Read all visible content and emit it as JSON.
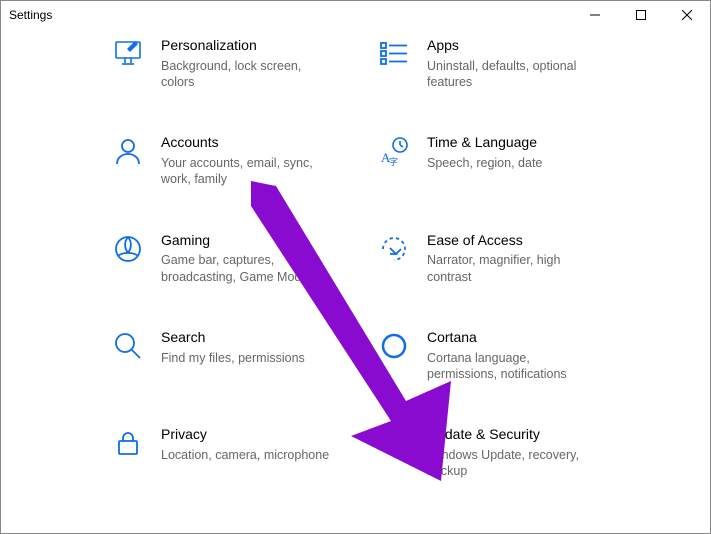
{
  "window": {
    "title": "Settings"
  },
  "colors": {
    "accent": "#0d6ee8",
    "desc": "#666666",
    "annotation": "#8a0bd0"
  },
  "tiles": [
    {
      "id": "personalization",
      "name": "Personalization",
      "desc": "Background, lock screen, colors"
    },
    {
      "id": "apps",
      "name": "Apps",
      "desc": "Uninstall, defaults, optional features"
    },
    {
      "id": "accounts",
      "name": "Accounts",
      "desc": "Your accounts, email, sync, work, family"
    },
    {
      "id": "time-language",
      "name": "Time & Language",
      "desc": "Speech, region, date"
    },
    {
      "id": "gaming",
      "name": "Gaming",
      "desc": "Game bar, captures, broadcasting, Game Mode"
    },
    {
      "id": "ease-of-access",
      "name": "Ease of Access",
      "desc": "Narrator, magnifier, high contrast"
    },
    {
      "id": "search",
      "name": "Search",
      "desc": "Find my files, permissions"
    },
    {
      "id": "cortana",
      "name": "Cortana",
      "desc": "Cortana language, permissions, notifications"
    },
    {
      "id": "privacy",
      "name": "Privacy",
      "desc": "Location, camera, microphone"
    },
    {
      "id": "update-security",
      "name": "Update & Security",
      "desc": "Windows Update, recovery, backup"
    }
  ]
}
